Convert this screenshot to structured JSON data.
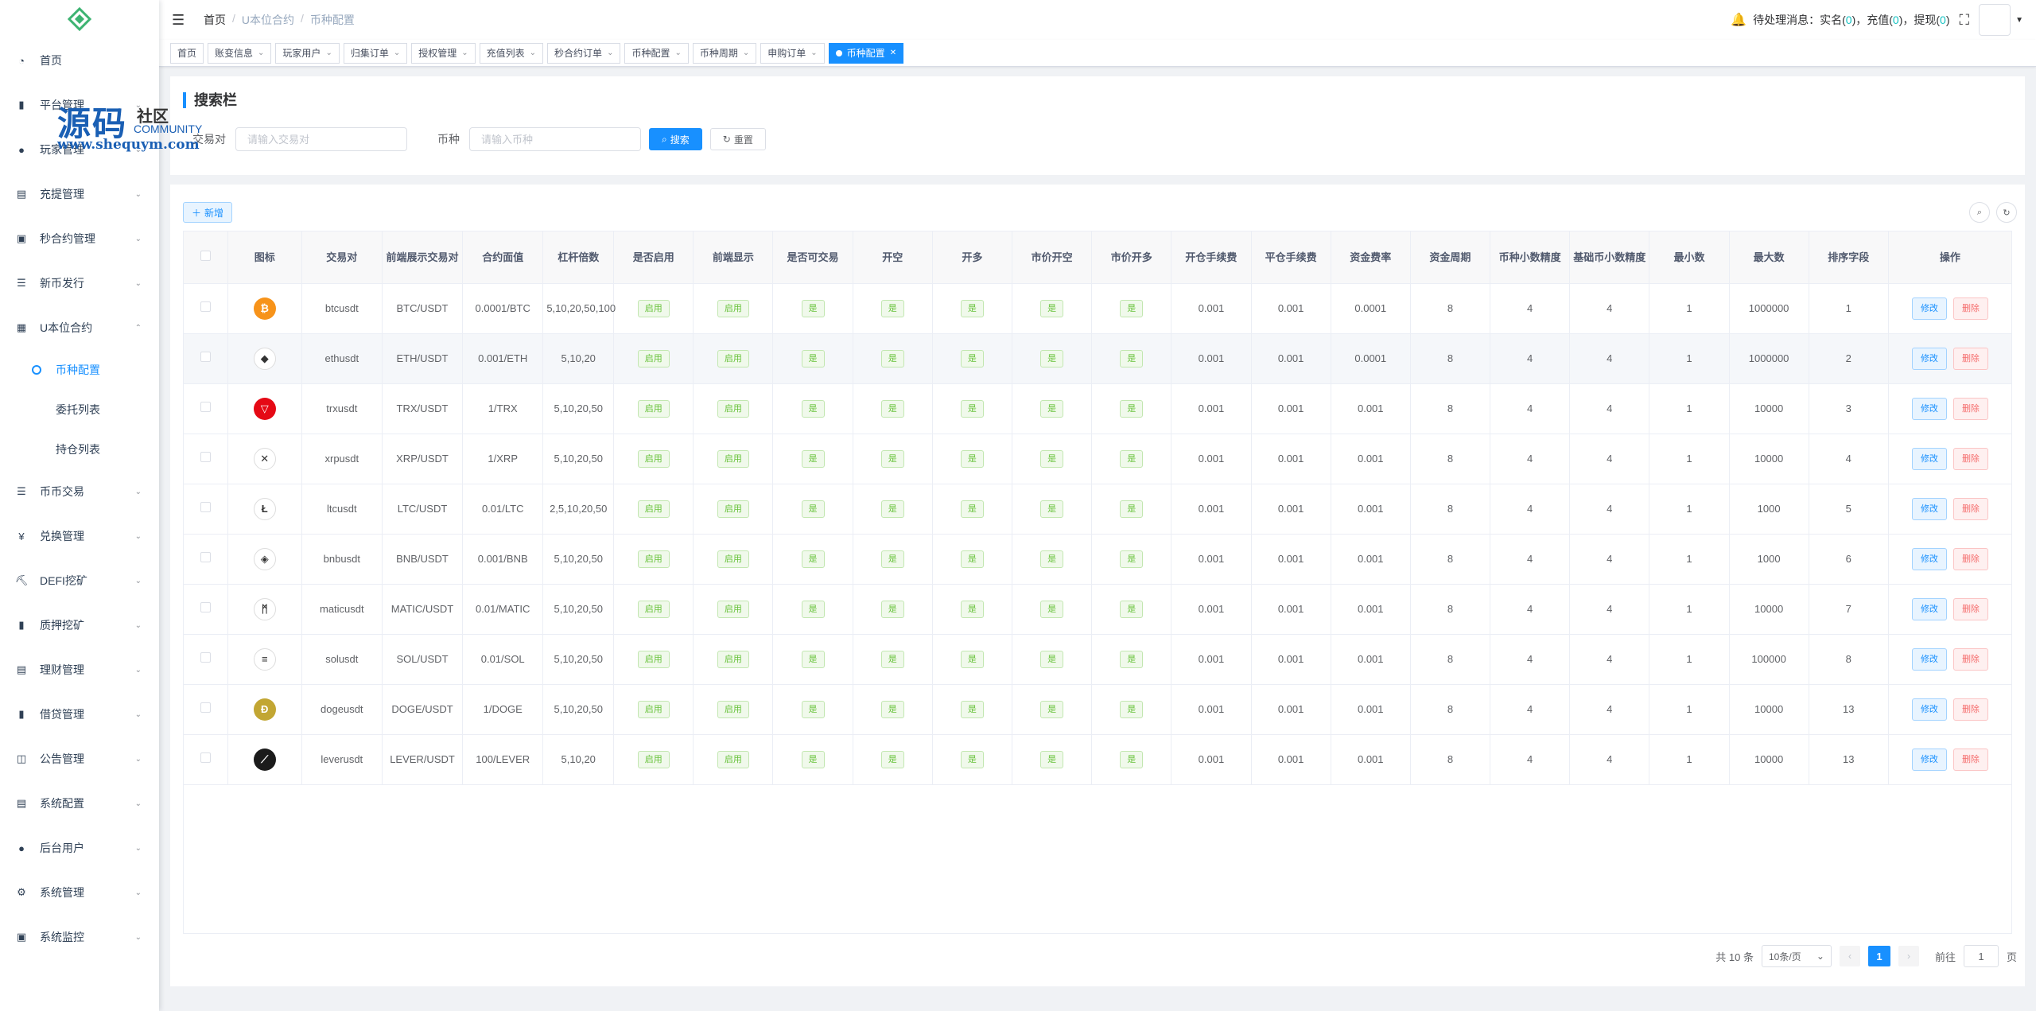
{
  "sidebar": {
    "items": [
      {
        "label": "首页",
        "icon": "dashboard-icon",
        "glyph": "◔",
        "arrow": ""
      },
      {
        "label": "平台管理",
        "icon": "platform-icon",
        "glyph": "▮",
        "arrow": "⌄"
      },
      {
        "label": "玩家管理",
        "icon": "user-icon",
        "glyph": "●",
        "arrow": "⌄"
      },
      {
        "label": "充提管理",
        "icon": "deposit-icon",
        "glyph": "▤",
        "arrow": "⌄"
      },
      {
        "label": "秒合约管理",
        "icon": "contract-icon",
        "glyph": "▣",
        "arrow": "⌄"
      },
      {
        "label": "新币发行",
        "icon": "issue-icon",
        "glyph": "☰",
        "arrow": "⌄"
      },
      {
        "label": "U本位合约",
        "icon": "grid-icon",
        "glyph": "▦",
        "arrow": "⌃"
      }
    ],
    "sub": [
      "币种配置",
      "委托列表",
      "持仓列表"
    ],
    "items2": [
      {
        "label": "币币交易",
        "icon": "list-icon",
        "glyph": "☰",
        "arrow": "⌄"
      },
      {
        "label": "兑换管理",
        "icon": "yen-icon",
        "glyph": "¥",
        "arrow": "⌄"
      },
      {
        "label": "DEFI挖矿",
        "icon": "mining-icon",
        "glyph": "⛏",
        "arrow": "⌄"
      },
      {
        "label": "质押挖矿",
        "icon": "bar-chart-icon",
        "glyph": "▮",
        "arrow": "⌄"
      },
      {
        "label": "理财管理",
        "icon": "finance-icon",
        "glyph": "▤",
        "arrow": "⌄"
      },
      {
        "label": "借贷管理",
        "icon": "loan-icon",
        "glyph": "▮",
        "arrow": "⌄"
      },
      {
        "label": "公告管理",
        "icon": "book-icon",
        "glyph": "◫",
        "arrow": "⌄"
      },
      {
        "label": "系统配置",
        "icon": "config-icon",
        "glyph": "▤",
        "arrow": "⌄"
      },
      {
        "label": "后台用户",
        "icon": "admin-user-icon",
        "glyph": "●",
        "arrow": "⌄"
      },
      {
        "label": "系统管理",
        "icon": "gear-icon",
        "glyph": "⚙",
        "arrow": "⌄"
      },
      {
        "label": "系统监控",
        "icon": "monitor-icon",
        "glyph": "▣",
        "arrow": "⌄"
      }
    ]
  },
  "watermark": {
    "big": "源码",
    "side": "社区",
    "community": "COMMUNITY",
    "url": "www.shequym.com"
  },
  "header": {
    "breadcrumb": [
      "首页",
      "U本位合约",
      "币种配置"
    ],
    "notice_prefix": "待处理消息：实名(",
    "notice_realname": "0",
    "notice_mid1": ")，充值(",
    "notice_recharge": "0",
    "notice_mid2": ")，提现(",
    "notice_withdraw": "0",
    "notice_suffix": ")"
  },
  "tags": [
    "首页",
    "账变信息",
    "玩家用户",
    "归集订单",
    "授权管理",
    "充值列表",
    "秒合约订单",
    "币种配置",
    "币种周期",
    "申购订单"
  ],
  "active_tag": "币种配置",
  "search": {
    "title": "搜索栏",
    "pair_label": "交易对",
    "pair_placeholder": "请输入交易对",
    "coin_label": "币种",
    "coin_placeholder": "请输入币种",
    "search_btn": "搜索",
    "reset_btn": "重置"
  },
  "toolbar": {
    "add_btn": "新增"
  },
  "table": {
    "headers": [
      "图标",
      "交易对",
      "前端展示交易对",
      "合约面值",
      "杠杆倍数",
      "是否启用",
      "前端显示",
      "是否可交易",
      "开空",
      "开多",
      "市价开空",
      "市价开多",
      "开仓手续费",
      "平仓手续费",
      "资金费率",
      "资金周期",
      "币种小数精度",
      "基础币小数精度",
      "最小数",
      "最大数",
      "排序字段",
      "操作"
    ],
    "enabled_label": "启用",
    "yes_label": "是",
    "edit_label": "修改",
    "delete_label": "删除",
    "rows": [
      {
        "icon": "bitcoin-icon",
        "iconColor": "#f7931a",
        "glyph": "₿",
        "pair": "btcusdt",
        "display": "BTC/USDT",
        "face": "0.0001/BTC",
        "leverage": "5,10,20,50,100",
        "openFee": "0.001",
        "closeFee": "0.001",
        "rate": "0.0001",
        "cycle": "8",
        "coinPrec": "4",
        "basePrec": "4",
        "min": "1",
        "max": "1000000",
        "sort": "1"
      },
      {
        "icon": "ethereum-icon",
        "iconColor": "#ffffff",
        "glyph": "◆",
        "pair": "ethusdt",
        "display": "ETH/USDT",
        "face": "0.001/ETH",
        "leverage": "5,10,20",
        "openFee": "0.001",
        "closeFee": "0.001",
        "rate": "0.0001",
        "cycle": "8",
        "coinPrec": "4",
        "basePrec": "4",
        "min": "1",
        "max": "1000000",
        "sort": "2"
      },
      {
        "icon": "tron-icon",
        "iconColor": "#e50915",
        "glyph": "▽",
        "pair": "trxusdt",
        "display": "TRX/USDT",
        "face": "1/TRX",
        "leverage": "5,10,20,50",
        "openFee": "0.001",
        "closeFee": "0.001",
        "rate": "0.001",
        "cycle": "8",
        "coinPrec": "4",
        "basePrec": "4",
        "min": "1",
        "max": "10000",
        "sort": "3"
      },
      {
        "icon": "xrp-icon",
        "iconColor": "#ffffff",
        "glyph": "✕",
        "pair": "xrpusdt",
        "display": "XRP/USDT",
        "face": "1/XRP",
        "leverage": "5,10,20,50",
        "openFee": "0.001",
        "closeFee": "0.001",
        "rate": "0.001",
        "cycle": "8",
        "coinPrec": "4",
        "basePrec": "4",
        "min": "1",
        "max": "10000",
        "sort": "4"
      },
      {
        "icon": "litecoin-icon",
        "iconColor": "#ffffff",
        "glyph": "Ł",
        "pair": "ltcusdt",
        "display": "LTC/USDT",
        "face": "0.01/LTC",
        "leverage": "2,5,10,20,50",
        "openFee": "0.001",
        "closeFee": "0.001",
        "rate": "0.001",
        "cycle": "8",
        "coinPrec": "4",
        "basePrec": "4",
        "min": "1",
        "max": "1000",
        "sort": "5"
      },
      {
        "icon": "bnb-icon",
        "iconColor": "#ffffff",
        "glyph": "◈",
        "pair": "bnbusdt",
        "display": "BNB/USDT",
        "face": "0.001/BNB",
        "leverage": "5,10,20,50",
        "openFee": "0.001",
        "closeFee": "0.001",
        "rate": "0.001",
        "cycle": "8",
        "coinPrec": "4",
        "basePrec": "4",
        "min": "1",
        "max": "1000",
        "sort": "6"
      },
      {
        "icon": "polygon-icon",
        "iconColor": "#ffffff",
        "glyph": "ᛗ",
        "pair": "maticusdt",
        "display": "MATIC/USDT",
        "face": "0.01/MATIC",
        "leverage": "5,10,20,50",
        "openFee": "0.001",
        "closeFee": "0.001",
        "rate": "0.001",
        "cycle": "8",
        "coinPrec": "4",
        "basePrec": "4",
        "min": "1",
        "max": "10000",
        "sort": "7"
      },
      {
        "icon": "solana-icon",
        "iconColor": "#ffffff",
        "glyph": "≡",
        "pair": "solusdt",
        "display": "SOL/USDT",
        "face": "0.01/SOL",
        "leverage": "5,10,20,50",
        "openFee": "0.001",
        "closeFee": "0.001",
        "rate": "0.001",
        "cycle": "8",
        "coinPrec": "4",
        "basePrec": "4",
        "min": "1",
        "max": "100000",
        "sort": "8"
      },
      {
        "icon": "dogecoin-icon",
        "iconColor": "#c2a633",
        "glyph": "Ð",
        "pair": "dogeusdt",
        "display": "DOGE/USDT",
        "face": "1/DOGE",
        "leverage": "5,10,20,50",
        "openFee": "0.001",
        "closeFee": "0.001",
        "rate": "0.001",
        "cycle": "8",
        "coinPrec": "4",
        "basePrec": "4",
        "min": "1",
        "max": "10000",
        "sort": "13"
      },
      {
        "icon": "lever-icon",
        "iconColor": "#1b1b1b",
        "glyph": "⟋",
        "pair": "leverusdt",
        "display": "LEVER/USDT",
        "face": "100/LEVER",
        "leverage": "5,10,20",
        "openFee": "0.001",
        "closeFee": "0.001",
        "rate": "0.001",
        "cycle": "8",
        "coinPrec": "4",
        "basePrec": "4",
        "min": "1",
        "max": "10000",
        "sort": "13"
      }
    ]
  },
  "pagination": {
    "total": "共 10 条",
    "page_size": "10条/页",
    "current": "1",
    "goto_label": "前往",
    "goto_value": "1",
    "page_unit": "页"
  },
  "colors": {
    "accent": "#1890ff",
    "success": "#67c23a",
    "danger": "#f56c6c"
  }
}
